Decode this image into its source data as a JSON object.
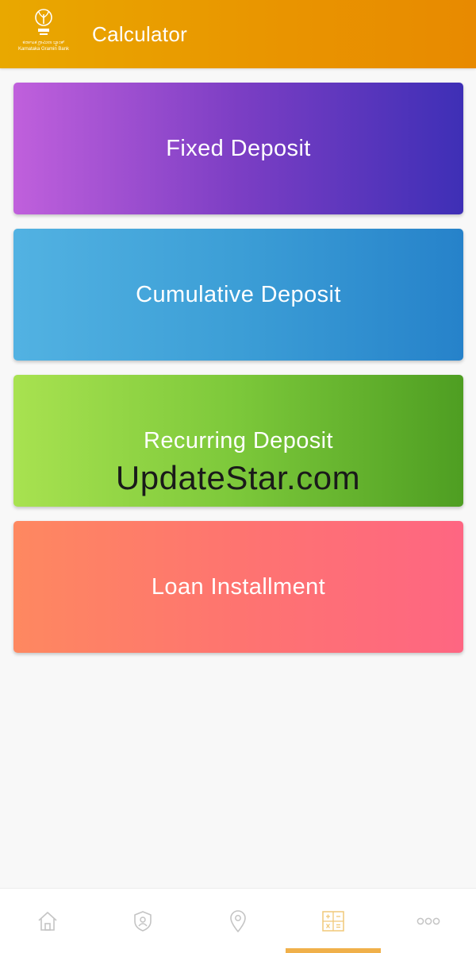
{
  "header": {
    "title": "Calculator",
    "logo_line1": "ಕರ್ನಾಟಕ ಗ್ರಾಮೀಣ ಬ್ಯಾಂಕ್",
    "logo_line2": "Karnataka Gramin Bank",
    "background": "#e99a00"
  },
  "cards": [
    {
      "label": "Fixed Deposit"
    },
    {
      "label": "Cumulative Deposit"
    },
    {
      "label": "Recurring Deposit"
    },
    {
      "label": "Loan Installment"
    }
  ],
  "watermark": "UpdateStar.com",
  "bottom_nav": {
    "items": [
      {
        "icon": "home-icon"
      },
      {
        "icon": "shield-user-icon"
      },
      {
        "icon": "location-pin-icon"
      },
      {
        "icon": "calculator-icon",
        "active": true
      },
      {
        "icon": "more-icon"
      }
    ],
    "icon_color": "#c4c4c4",
    "active_color": "#f0b04a"
  }
}
